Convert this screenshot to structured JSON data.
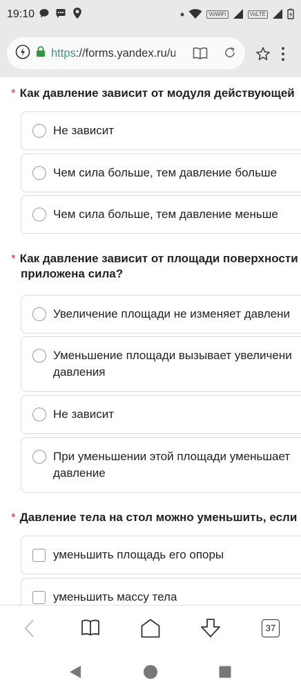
{
  "status_bar": {
    "time": "19:10",
    "network_labels": [
      "VoWiFi",
      "VoLTE"
    ]
  },
  "browser": {
    "url_scheme": "https",
    "url_rest": "://forms.yandex.ru/u",
    "tab_count": "37"
  },
  "questions": [
    {
      "required": "*",
      "lines": [
        "Как давление зависит от модуля действующей"
      ],
      "type": "radio",
      "options": [
        {
          "lines": [
            "Не зависит"
          ]
        },
        {
          "lines": [
            "Чем сила больше, тем давление больше"
          ]
        },
        {
          "lines": [
            "Чем сила больше, тем давление меньше"
          ]
        }
      ]
    },
    {
      "required": "*",
      "lines": [
        "Как давление зависит от площади поверхности",
        "приложена сила?"
      ],
      "type": "radio",
      "options": [
        {
          "lines": [
            "Увеличение площади не изменяет давлени"
          ]
        },
        {
          "lines": [
            "Уменьшение площади вызывает увеличени",
            "давления"
          ]
        },
        {
          "lines": [
            "Не зависит"
          ]
        },
        {
          "lines": [
            "При уменьшении этой площади уменьшает",
            "давление"
          ]
        }
      ]
    },
    {
      "required": "*",
      "lines": [
        "Давление тела на стол можно уменьшить, если"
      ],
      "type": "checkbox",
      "options": [
        {
          "lines": [
            "уменьшить площадь его опоры"
          ]
        },
        {
          "lines": [
            "уменьшить массу тела"
          ]
        }
      ]
    }
  ],
  "colors": {
    "required_mark": "#e0302a",
    "secure_lock": "#2e9a3e",
    "url_scheme": "#3a9a8a"
  }
}
